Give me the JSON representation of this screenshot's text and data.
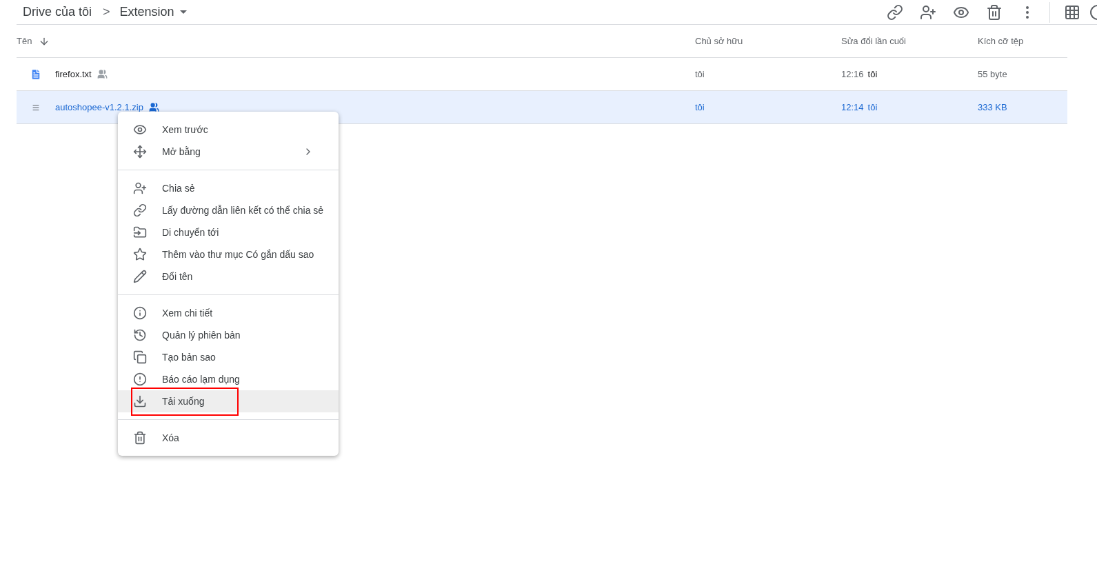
{
  "breadcrumb": {
    "root": "Drive của tôi",
    "separator": ">",
    "current": "Extension"
  },
  "table": {
    "columns": [
      {
        "label": "Tên",
        "sorted": true
      },
      {
        "label": "Chủ sở hữu",
        "sorted": false
      },
      {
        "label": "Sửa đổi lần cuối",
        "sorted": false
      },
      {
        "label": "Kích cỡ tệp",
        "sorted": false
      }
    ],
    "rows": [
      {
        "name": "firefox.txt",
        "kind": "text",
        "owner": "tôi",
        "time": "12:16",
        "modifier": "tôi",
        "size": "55 byte",
        "selected": false
      },
      {
        "name": "autoshopee-v1.2.1.zip",
        "kind": "archive",
        "owner": "tôi",
        "time": "12:14",
        "modifier": "tôi",
        "size": "333 KB",
        "selected": true
      }
    ]
  },
  "context_menu": {
    "groups": [
      [
        {
          "label": "Xem trước",
          "submenu": false,
          "highlighted": false,
          "annotated": false
        },
        {
          "label": "Mở bằng",
          "submenu": true,
          "highlighted": false,
          "annotated": false
        }
      ],
      [
        {
          "label": "Chia sẻ",
          "submenu": false,
          "highlighted": false,
          "annotated": false
        },
        {
          "label": "Lấy đường dẫn liên kết có thể chia sẻ",
          "submenu": false,
          "highlighted": false,
          "annotated": false
        },
        {
          "label": "Di chuyển tới",
          "submenu": false,
          "highlighted": false,
          "annotated": false
        },
        {
          "label": "Thêm vào thư mục Có gắn dấu sao",
          "submenu": false,
          "highlighted": false,
          "annotated": false
        },
        {
          "label": "Đổi tên",
          "submenu": false,
          "highlighted": false,
          "annotated": false
        }
      ],
      [
        {
          "label": "Xem chi tiết",
          "submenu": false,
          "highlighted": false,
          "annotated": false
        },
        {
          "label": "Quản lý phiên bản",
          "submenu": false,
          "highlighted": false,
          "annotated": false
        },
        {
          "label": "Tạo bản sao",
          "submenu": false,
          "highlighted": false,
          "annotated": false
        },
        {
          "label": "Báo cáo lạm dụng",
          "submenu": false,
          "highlighted": false,
          "annotated": false
        },
        {
          "label": "Tải xuống",
          "submenu": false,
          "highlighted": true,
          "annotated": true
        }
      ],
      [
        {
          "label": "Xóa",
          "submenu": false,
          "highlighted": false,
          "annotated": false
        }
      ]
    ]
  }
}
